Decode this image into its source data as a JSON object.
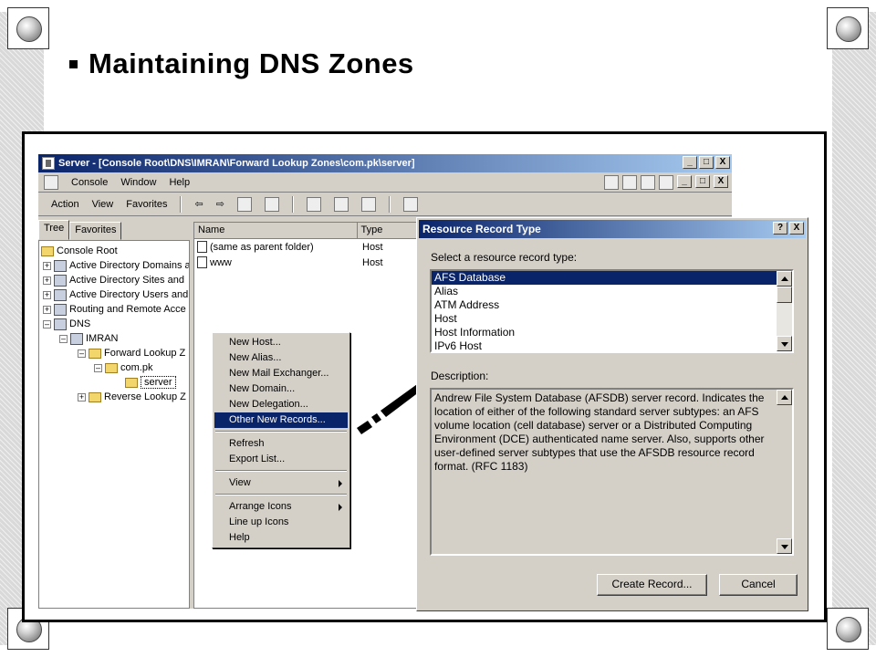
{
  "slide": {
    "title": "Maintaining DNS Zones"
  },
  "mmc": {
    "title": "Server - [Console Root\\DNS\\IMRAN\\Forward Lookup Zones\\com.pk\\server]",
    "window_buttons": [
      "_",
      "□",
      "X"
    ],
    "menu": [
      "Console",
      "Window",
      "Help"
    ],
    "action_menu": [
      "Action",
      "View",
      "Favorites"
    ],
    "tabs": [
      "Tree",
      "Favorites"
    ],
    "tree": [
      "Console Root",
      "Active Directory Domains a",
      "Active Directory Sites and",
      "Active Directory Users and",
      "Routing and Remote Acce",
      "DNS",
      "IMRAN",
      "Forward Lookup Z",
      "com.pk",
      "server",
      "Reverse Lookup Z"
    ],
    "columns": [
      "Name",
      "Type"
    ],
    "rows": [
      {
        "name": "(same as parent folder)",
        "type": "Host"
      },
      {
        "name": "www",
        "type": "Host"
      }
    ]
  },
  "context_menu": {
    "items": [
      "New Host...",
      "New Alias...",
      "New Mail Exchanger...",
      "New Domain...",
      "New Delegation...",
      "Other New Records..."
    ],
    "items2": [
      "Refresh",
      "Export List..."
    ],
    "items3": [
      "View"
    ],
    "items4": [
      "Arrange Icons",
      "Line up Icons",
      "Help"
    ]
  },
  "dialog": {
    "title": "Resource Record Type",
    "help_btn": "?",
    "close_btn": "X",
    "select_label": "Select a resource record type:",
    "record_types": [
      "AFS Database",
      "Alias",
      "ATM Address",
      "Host",
      "Host Information",
      "IPv6 Host"
    ],
    "selected": "AFS Database",
    "desc_label": "Description:",
    "description": "Andrew File System Database (AFSDB) server record. Indicates the location of either of the following standard server subtypes: an AFS volume location (cell database) server or a Distributed Computing Environment (DCE) authenticated name server. Also, supports other user-defined server subtypes that use the AFSDB resource record format. (RFC 1183)",
    "create_btn": "Create Record...",
    "cancel_btn": "Cancel"
  }
}
